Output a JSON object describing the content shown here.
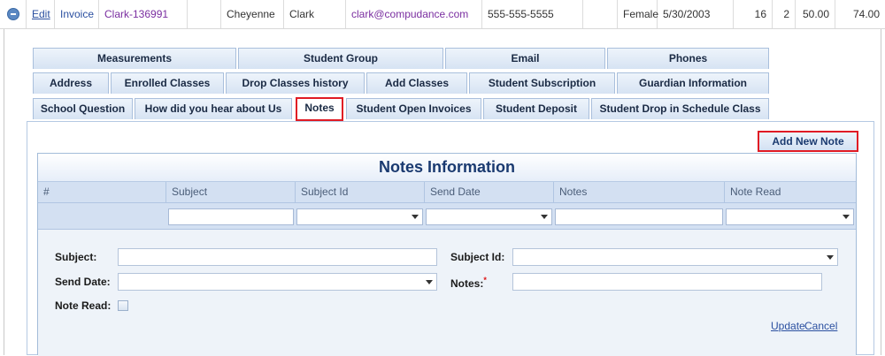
{
  "row": {
    "edit": "Edit",
    "invoice": "Invoice",
    "account": "Clark-136991",
    "first_name": "Cheyenne",
    "last_name": "Clark",
    "email": "clark@compudance.com",
    "phone": "555-555-5555",
    "gender": "Female",
    "dob": "5/30/2003",
    "age": "16",
    "count": "2",
    "amount1": "50.00",
    "amount2": "74.00"
  },
  "tabs": {
    "row1": [
      "Measurements",
      "Student Group",
      "Email",
      "Phones"
    ],
    "row2": [
      "Address",
      "Enrolled Classes",
      "Drop Classes history",
      "Add Classes",
      "Student Subscription",
      "Guardian Information"
    ],
    "row3": [
      "School Question",
      "How did you hear about Us",
      "Notes",
      "Student Open Invoices",
      "Student Deposit",
      "Student Drop in Schedule Class"
    ],
    "selected": "Notes"
  },
  "add_button": "Add New Note",
  "grid": {
    "title": "Notes Information",
    "columns": [
      "#",
      "Subject",
      "Subject Id",
      "Send Date",
      "Notes",
      "Note Read"
    ]
  },
  "form": {
    "subject_label": "Subject:",
    "subject_id_label": "Subject Id:",
    "send_date_label": "Send Date:",
    "notes_label": "Notes:",
    "required_mark": "*",
    "note_read_label": "Note Read:",
    "update": "Update",
    "cancel": "Cancel"
  },
  "colors": {
    "highlight": "#e01b24",
    "header_bg": "#d3e0f2",
    "title_text": "#1a3a70"
  }
}
